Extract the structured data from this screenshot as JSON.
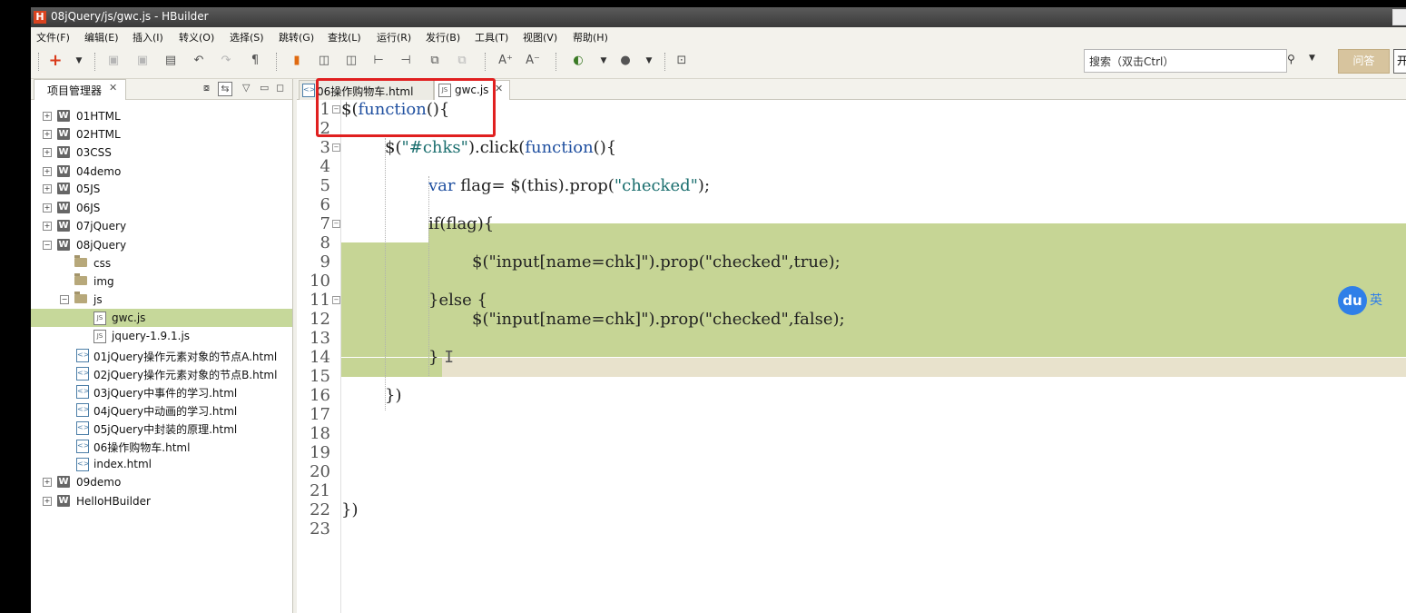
{
  "window": {
    "title": "08jQuery/js/gwc.js  -  HBuilder",
    "logo": "H"
  },
  "menu": [
    "文件(F)",
    "编辑(E)",
    "插入(I)",
    "转义(O)",
    "选择(S)",
    "跳转(G)",
    "查找(L)",
    "运行(R)",
    "发行(B)",
    "工具(T)",
    "视图(V)",
    "帮助(H)"
  ],
  "toolbar": {
    "search_placeholder": "搜索（双击Ctrl）",
    "search_icon": "search-icon",
    "qa_label": "问答",
    "open_label": "开"
  },
  "project": {
    "tab_label": "项目管理器",
    "tree": [
      {
        "label": "01HTML",
        "type": "project",
        "expanded": false
      },
      {
        "label": "02HTML",
        "type": "project",
        "expanded": false
      },
      {
        "label": "03CSS",
        "type": "project",
        "expanded": false
      },
      {
        "label": "04demo",
        "type": "project",
        "expanded": false
      },
      {
        "label": "05JS",
        "type": "project",
        "expanded": false
      },
      {
        "label": "06JS",
        "type": "project",
        "expanded": false
      },
      {
        "label": "07jQuery",
        "type": "project",
        "expanded": false
      },
      {
        "label": "08jQuery",
        "type": "project",
        "expanded": true
      },
      {
        "label": "css",
        "type": "folder"
      },
      {
        "label": "img",
        "type": "folder"
      },
      {
        "label": "js",
        "type": "folder",
        "expanded": true
      },
      {
        "label": "gwc.js",
        "type": "js",
        "selected": true
      },
      {
        "label": "jquery-1.9.1.js",
        "type": "js"
      },
      {
        "label": "01jQuery操作元素对象的节点A.html",
        "type": "html"
      },
      {
        "label": "02jQuery操作元素对象的节点B.html",
        "type": "html"
      },
      {
        "label": "03jQuery中事件的学习.html",
        "type": "html"
      },
      {
        "label": "04jQuery中动画的学习.html",
        "type": "html"
      },
      {
        "label": "05jQuery中封装的原理.html",
        "type": "html"
      },
      {
        "label": "06操作购物车.html",
        "type": "html"
      },
      {
        "label": "index.html",
        "type": "html"
      },
      {
        "label": "09demo",
        "type": "project",
        "expanded": false
      },
      {
        "label": "HelloHBuilder",
        "type": "project",
        "expanded": false
      }
    ]
  },
  "editor": {
    "tabs": [
      {
        "label": "06操作购物车.html",
        "active": false
      },
      {
        "label": "gwc.js",
        "active": true
      }
    ],
    "lines": [
      {
        "n": "1",
        "code": "$(function(){"
      },
      {
        "n": "2",
        "code": ""
      },
      {
        "n": "3",
        "code": "    $(\"#chks\").click(function(){"
      },
      {
        "n": "4",
        "code": ""
      },
      {
        "n": "5",
        "code": "        var flag= $(this).prop(\"checked\");"
      },
      {
        "n": "6",
        "code": ""
      },
      {
        "n": "7",
        "code": "        if(flag){"
      },
      {
        "n": "8",
        "code": ""
      },
      {
        "n": "9",
        "code": "            $(\"input[name=chk]\").prop(\"checked\",true);"
      },
      {
        "n": "10",
        "code": ""
      },
      {
        "n": "11",
        "code": "        }else {"
      },
      {
        "n": "12",
        "code": "            $(\"input[name=chk]\").prop(\"checked\",false);"
      },
      {
        "n": "13",
        "code": ""
      },
      {
        "n": "14",
        "code": "        }"
      },
      {
        "n": "15",
        "code": ""
      },
      {
        "n": "16",
        "code": "    })"
      },
      {
        "n": "17",
        "code": ""
      },
      {
        "n": "18",
        "code": ""
      },
      {
        "n": "19",
        "code": ""
      },
      {
        "n": "20",
        "code": ""
      },
      {
        "n": "21",
        "code": ""
      },
      {
        "n": "22",
        "code": "})"
      },
      {
        "n": "23",
        "code": ""
      }
    ]
  },
  "baidu_ime": {
    "logo": "du",
    "mode": "英"
  }
}
